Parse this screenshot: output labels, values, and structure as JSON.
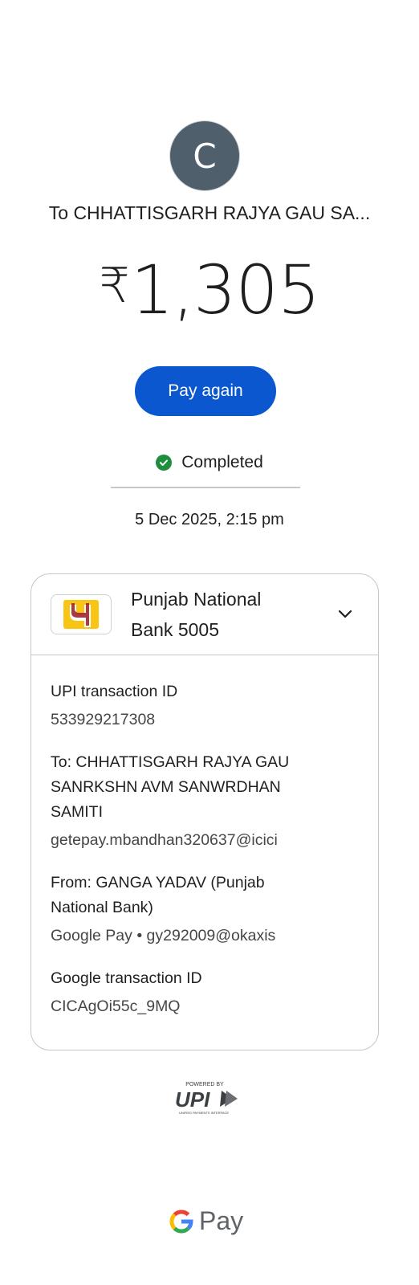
{
  "avatar": {
    "initial": "C",
    "color": "#4f5f6b"
  },
  "payee_title": "To CHHATTISGARH RAJYA GAU SA...",
  "amount": {
    "currency": "₹",
    "value": "1,305"
  },
  "pay_again_label": "Pay again",
  "status": {
    "text": "Completed",
    "icon": "check-circle-icon",
    "color": "#1e8e3e"
  },
  "datetime": "5 Dec 2025, 2:15 pm",
  "account": {
    "bank_name_line1": "Punjab National",
    "bank_name_line2": "Bank 5005",
    "logo_icon": "pnb-logo-icon",
    "expand_icon": "chevron-down-icon"
  },
  "details": {
    "upi_label": "UPI transaction ID",
    "upi_value": "533929217308",
    "to_label_1": "To: CHHATTISGARH RAJYA GAU",
    "to_label_2": "SANRKSHN AVM SANWRDHAN",
    "to_label_3": "SAMITI",
    "to_value": "getepay.mbandhan320637@icici",
    "from_label_1": "From: GANGA YADAV (Punjab",
    "from_label_2": "National Bank)",
    "from_value": "Google Pay • gy292009@okaxis",
    "google_label": "Google transaction ID",
    "google_value": "CICAgOi55c_9MQ"
  },
  "footer": {
    "powered_by": "POWERED BY",
    "upi_text": "UPI",
    "upi_tagline": "UNIFIED PAYMENTS INTERFACE",
    "gpay_text": "Pay"
  },
  "colors": {
    "accent": "#0b57d0",
    "border": "#c4c7c5",
    "secondary_text": "#444746"
  }
}
